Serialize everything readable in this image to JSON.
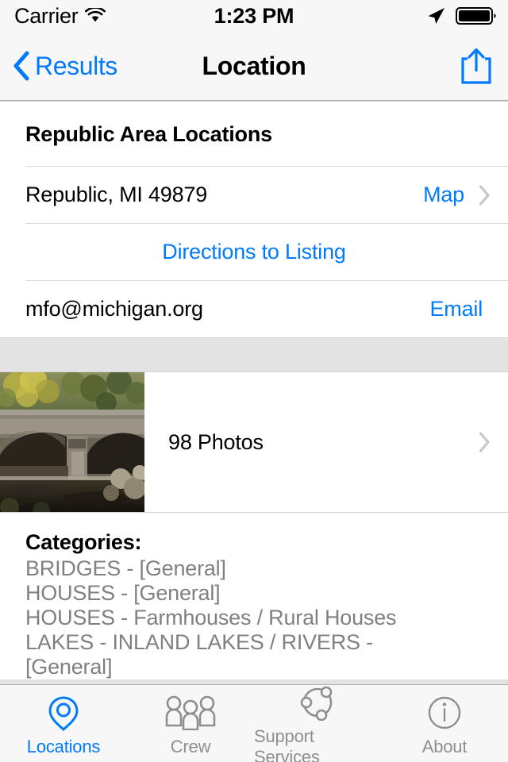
{
  "status_bar": {
    "carrier": "Carrier",
    "wifi_icon": "wifi-icon",
    "time": "1:23 PM",
    "location_icon": "location-arrow-icon",
    "battery_icon": "battery-full-icon"
  },
  "nav_bar": {
    "back_label": "Results",
    "back_icon": "chevron-left-icon",
    "title": "Location",
    "share_icon": "share-icon"
  },
  "location_card": {
    "title": "Republic Area Locations",
    "address": "Republic, MI 49879",
    "map_link": "Map",
    "directions_link": "Directions to Listing",
    "email_address": "mfo@michigan.org",
    "email_link": "Email"
  },
  "photos_row": {
    "label": "98 Photos",
    "thumbnail": "stone-arch-bridge-photo",
    "chevron_icon": "chevron-right-icon"
  },
  "categories": {
    "heading": "Categories:",
    "items": [
      "BRIDGES - [General]",
      "HOUSES - [General]",
      "HOUSES - Farmhouses / Rural Houses",
      "LAKES - INLAND LAKES / RIVERS -",
      "[General]"
    ]
  },
  "tab_bar": {
    "items": [
      {
        "label": "Locations",
        "icon": "map-pin-icon",
        "active": true
      },
      {
        "label": "Crew",
        "icon": "people-group-icon",
        "active": false
      },
      {
        "label": "Support Services",
        "icon": "network-nodes-icon",
        "active": false
      },
      {
        "label": "About",
        "icon": "info-circle-icon",
        "active": false
      }
    ]
  },
  "colors": {
    "accent": "#007aff",
    "inactive": "#8e8e93",
    "bar_background": "#f7f7f7",
    "page_background": "#e3e3e3",
    "secondary_text": "#808080"
  }
}
